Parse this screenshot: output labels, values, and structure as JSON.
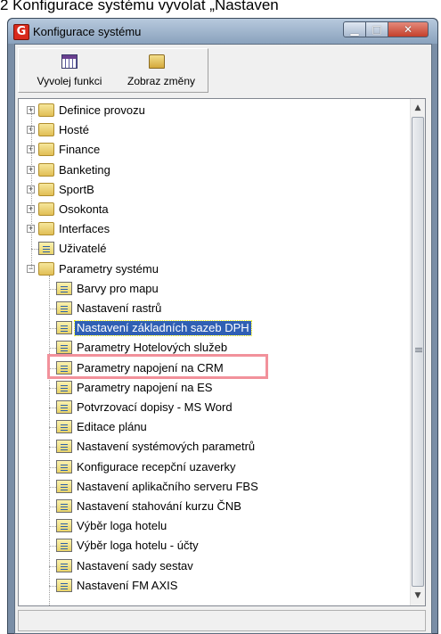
{
  "top_text": "2 Konfigurace systému vyvolat „Nastaven",
  "window": {
    "title": "Konfigurace systému",
    "icon_letter": "G"
  },
  "toolbar": {
    "invoke_label": "Vyvolej funkci",
    "show_changes_label": "Zobraz změny"
  },
  "tree": {
    "items": [
      {
        "label": "Definice provozu",
        "type": "folder",
        "expander": "+"
      },
      {
        "label": "Hosté",
        "type": "folder",
        "expander": "+"
      },
      {
        "label": "Finance",
        "type": "folder",
        "expander": "+"
      },
      {
        "label": "Banketing",
        "type": "folder",
        "expander": "+"
      },
      {
        "label": "SportB",
        "type": "folder",
        "expander": "+"
      },
      {
        "label": "Osokonta",
        "type": "folder",
        "expander": "+"
      },
      {
        "label": "Interfaces",
        "type": "folder",
        "expander": "+"
      },
      {
        "label": "Uživatelé",
        "type": "doc"
      },
      {
        "label": "Parametry systému",
        "type": "folder",
        "expander": "−"
      },
      {
        "label": "Barvy pro mapu",
        "type": "doc"
      },
      {
        "label": "Nastavení rastrů",
        "type": "doc"
      },
      {
        "label": "Nastavení základních sazeb DPH",
        "type": "doc",
        "selected": true
      },
      {
        "label": "Parametry Hotelových služeb",
        "type": "doc"
      },
      {
        "label": "Parametry napojení na CRM",
        "type": "doc"
      },
      {
        "label": "Parametry napojení na ES",
        "type": "doc"
      },
      {
        "label": "Potvrzovací dopisy - MS Word",
        "type": "doc"
      },
      {
        "label": "Editace plánu",
        "type": "doc"
      },
      {
        "label": "Nastavení systémových parametrů",
        "type": "doc"
      },
      {
        "label": "Konfigurace recepční uzaverky",
        "type": "doc"
      },
      {
        "label": "Nastavení aplikačního serveru FBS",
        "type": "doc"
      },
      {
        "label": "Nastavení stahování kurzu ČNB",
        "type": "doc"
      },
      {
        "label": "Výběr loga hotelu",
        "type": "doc"
      },
      {
        "label": "Výběr loga hotelu - účty",
        "type": "doc"
      },
      {
        "label": "Nastavení sady sestav",
        "type": "doc"
      },
      {
        "label": "Nastavení FM AXIS",
        "type": "doc"
      }
    ]
  },
  "colors": {
    "selection": "#2f5fb4",
    "highlight_box": "#f2919b"
  },
  "icons": {
    "app": "app-logo-icon",
    "invoke": "calendar-grid-icon",
    "show_changes": "folder-icon"
  }
}
